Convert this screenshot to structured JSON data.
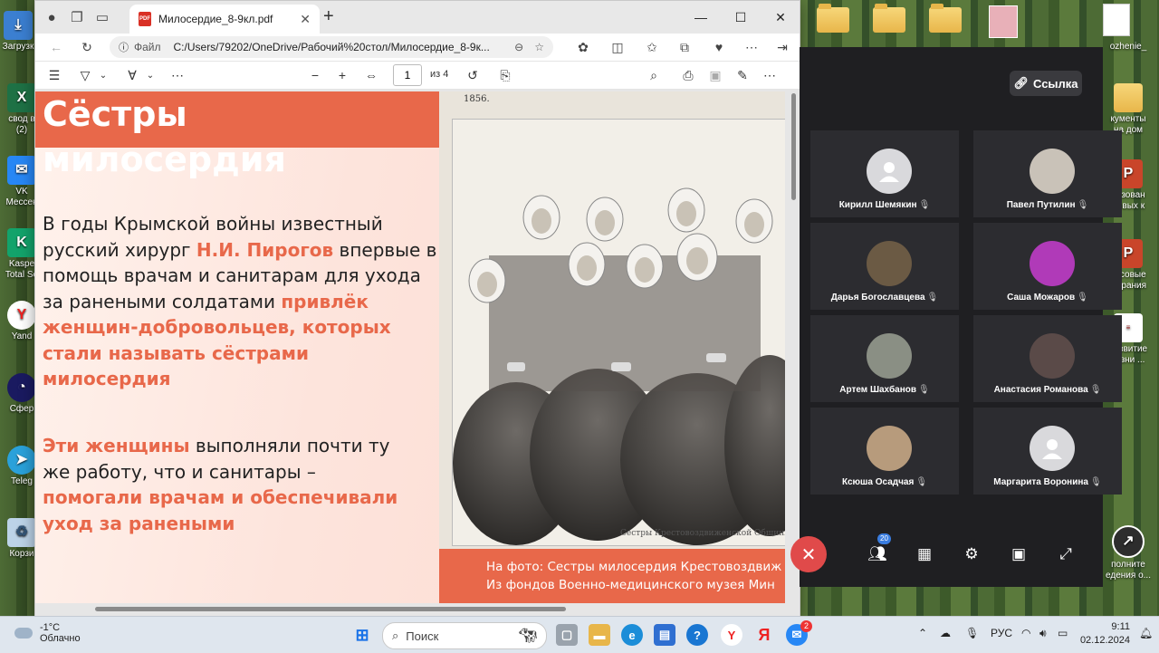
{
  "browser": {
    "tab_title": "Милосердие_8-9кл.pdf",
    "url_prefix": "Файл",
    "url": "C:/Users/79202/OneDrive/Рабочий%20стол/Милосердие_8-9к...",
    "page_current": "1",
    "page_of": "из 4"
  },
  "slide": {
    "title": "Сёстры милосердия",
    "p1_a": "В годы Крымской войны известный русский хирург ",
    "p1_name": "Н.И. Пирогов",
    "p1_b": " впервые в помощь врачам и санитарам для ухода за ранеными солдатами ",
    "p1_hl": "привлёк женщин-добровольцев, которых стали называть сёстрами милосердия",
    "p2_hl1": "Эти женщины",
    "p2_a": " выполняли почти ту же работу, что и санитары – ",
    "p2_hl2": "помогали врачам и обеспечивали уход за ранеными",
    "photo_year": "1856.",
    "photo_caption_small": "Сестры Крестовоздвиженской Общины попечени",
    "caption_line1": "На фото: Сестры милосердия Крестовоздвиж",
    "caption_line2": "Из фондов Военно-медицинского музея Мин"
  },
  "meeting": {
    "link_label": "Ссылка",
    "participants_count": "20",
    "participants": [
      {
        "name": "Кирилл Шемякин",
        "avatar": "placeholder",
        "color": "#d9d9dc"
      },
      {
        "name": "Павел Путилин",
        "avatar": "photo",
        "color": "#c9c2b8"
      },
      {
        "name": "Дарья Богославцева",
        "avatar": "photo",
        "color": "#6b5a44"
      },
      {
        "name": "Саша Можаров",
        "avatar": "photo",
        "color": "#b03ab8"
      },
      {
        "name": "Артем Шахбанов",
        "avatar": "photo",
        "color": "#8a8f84"
      },
      {
        "name": "Анастасия Романова",
        "avatar": "photo",
        "color": "#5a4a48"
      },
      {
        "name": "Ксюша Осадчая",
        "avatar": "photo",
        "color": "#b79b7c"
      },
      {
        "name": "Маргарита Воронина",
        "avatar": "placeholder",
        "color": "#d9d9dc"
      }
    ]
  },
  "desktop": {
    "left_icons": [
      "Загрузк",
      "свод в\n(2)",
      "VK\nМессен",
      "Kaspe\nTotal Se",
      "Yand",
      "Сфер",
      "Teleg",
      "Корзи"
    ],
    "right_icons": [
      "ozhenie_",
      "кументы\nна дом",
      "разован\nловых к",
      "ассовые\nмирания",
      "развитие\nкизни ...",
      "полните\nедения о..."
    ]
  },
  "taskbar": {
    "weather_temp": "-1°C",
    "weather_text": "Облачно",
    "search_placeholder": "Поиск",
    "lang": "РУС",
    "time": "9:11",
    "date": "02.12.2024",
    "notif_badge": "2"
  }
}
